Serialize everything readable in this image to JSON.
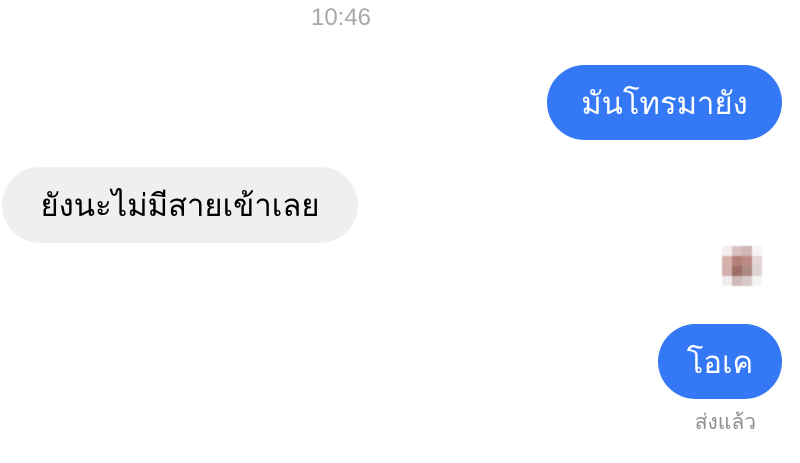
{
  "conversation": {
    "timestamp": "10:46",
    "messages": [
      {
        "direction": "sent",
        "text": "มันโทรมายัง"
      },
      {
        "direction": "received",
        "text": "ยังนะไม่มีสายเข้าเลย"
      },
      {
        "direction": "sent",
        "text": "โอเค"
      }
    ],
    "receipt": "ส่งแล้ว"
  },
  "colors": {
    "sent_bubble": "#3478f6",
    "received_bubble": "#efeff1",
    "timestamp_text": "#a8a8ad",
    "receipt_text": "#8e8e93"
  },
  "icons": {
    "read_avatar": "pixelated-avatar-icon"
  }
}
